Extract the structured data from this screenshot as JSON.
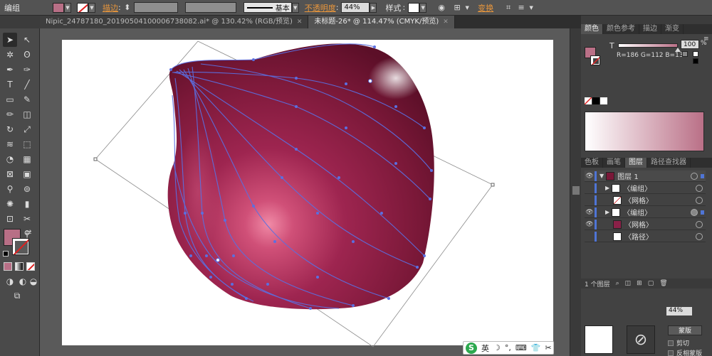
{
  "control_bar": {
    "selection_label": "编组",
    "fill_color": "#b86f86",
    "stroke_label": "描边",
    "stroke_style": "基本",
    "opacity_label": "不透明度",
    "opacity_value": "44%",
    "style_label": "样式",
    "transform_label": "变换"
  },
  "tabs": [
    {
      "title": "Nipic_24787180_20190504100006738082.ai* @ 130.42% (RGB/预览)"
    },
    {
      "title": "未标题-26* @ 114.47% (CMYK/预览)"
    }
  ],
  "color_panel": {
    "tabs": [
      "颜色",
      "颜色参考",
      "描边",
      "渐变"
    ],
    "t_label": "T",
    "t_value": "100",
    "rgb_readout": "R=186 G=112 B=135",
    "current_color": "#ba7087"
  },
  "layers_panel": {
    "tabs": [
      "色板",
      "画笔",
      "图层",
      "路径查找器"
    ],
    "layer_name": "图层 1",
    "items": [
      {
        "label": "〈编组〉"
      },
      {
        "label": "〈网格〉"
      },
      {
        "label": "〈编组〉"
      },
      {
        "label": "〈网格〉"
      },
      {
        "label": "〈路径〉"
      }
    ],
    "layer_count": "1 个图层"
  },
  "bottom_panel": {
    "percent": "44%",
    "mask_button": "蒙版",
    "clip_label": "剪切",
    "invert_label": "反相蒙版"
  },
  "ime": {
    "brand": "S",
    "lang": "英"
  },
  "colors": {
    "ui_dark": "#3c3c3c",
    "accent_orange": "#e8963c",
    "path_blue": "#5b6fe0",
    "onion_dark": "#7a1838",
    "onion_mid": "#a02a52",
    "onion_highlight": "#f08aa6"
  }
}
